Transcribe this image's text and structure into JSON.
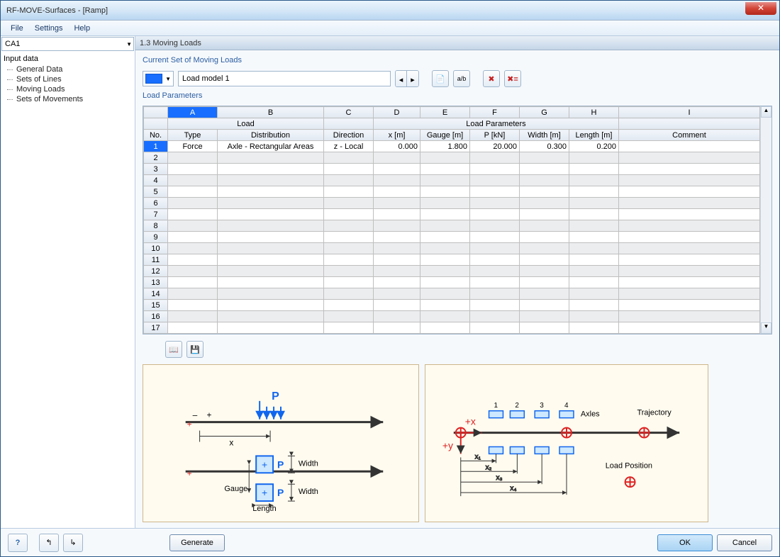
{
  "window": {
    "title": "RF-MOVE-Surfaces - [Ramp]"
  },
  "menu": {
    "file": "File",
    "settings": "Settings",
    "help": "Help"
  },
  "nav": {
    "combo": "CA1",
    "root": "Input data",
    "items": [
      "General Data",
      "Sets of Lines",
      "Moving Loads",
      "Sets of Movements"
    ]
  },
  "page": {
    "title": "1.3 Moving Loads"
  },
  "section": {
    "currentSet": "Current Set of Moving Loads",
    "loadParams": "Load Parameters"
  },
  "loadSet": {
    "id": "1",
    "name": "Load model 1"
  },
  "grid": {
    "cols": [
      "A",
      "B",
      "C",
      "D",
      "E",
      "F",
      "G",
      "H",
      "I"
    ],
    "groupLoad": "Load",
    "groupParams": "Load Parameters",
    "hdr": {
      "no": "No.",
      "type": "Type",
      "dist": "Distribution",
      "dir": "Direction",
      "x": "x [m]",
      "gauge": "Gauge [m]",
      "p": "P [kN]",
      "width": "Width [m]",
      "len": "Length [m]",
      "comment": "Comment"
    },
    "row1": {
      "no": "1",
      "type": "Force",
      "dist": "Axle - Rectangular Areas",
      "dir": "z - Local",
      "x": "0.000",
      "gauge": "1.800",
      "p": "20.000",
      "width": "0.300",
      "len": "0.200"
    },
    "rowCount": 17
  },
  "footer": {
    "generate": "Generate",
    "ok": "OK",
    "cancel": "Cancel"
  },
  "diagram": {
    "P": "P",
    "x": "x",
    "width": "Width",
    "gauge": "Gauge",
    "length": "Length",
    "minus": "–",
    "plus": "+",
    "axles": "Axles",
    "trajectory": "Trajectory",
    "loadPos": "Load Position",
    "plusX": "+x",
    "plusY": "+y",
    "n1": "1",
    "n2": "2",
    "n3": "3",
    "n4": "4",
    "x1": "x₁",
    "x2": "x₂",
    "x3": "x₃",
    "x4": "x₄"
  }
}
